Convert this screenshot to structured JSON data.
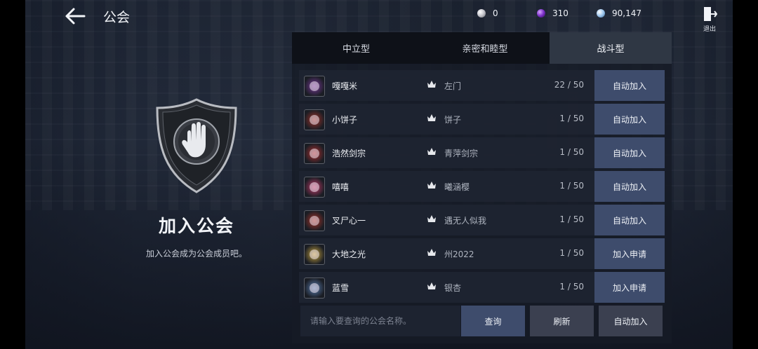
{
  "header": {
    "title": "公会",
    "exit_label": "退出"
  },
  "currencies": [
    {
      "icon": "pearl-icon",
      "value": "0"
    },
    {
      "icon": "purple-gem-icon",
      "value": "310"
    },
    {
      "icon": "crystal-icon",
      "value": "90,147"
    }
  ],
  "left": {
    "title": "加入公会",
    "desc": "加入公会成为公会成员吧。"
  },
  "tabs": [
    {
      "label": "中立型",
      "active": false
    },
    {
      "label": "亲密和睦型",
      "active": false
    },
    {
      "label": "战斗型",
      "active": true
    }
  ],
  "guilds": [
    {
      "name": "嘎嘎米",
      "leader": "左门",
      "count": "22 / 50",
      "action": "自动加入",
      "emblem_color": "#7a3a9a"
    },
    {
      "name": "小饼子",
      "leader": "饼子",
      "count": "1 / 50",
      "action": "自动加入",
      "emblem_color": "#a0322a"
    },
    {
      "name": "浩然剑宗",
      "leader": "青萍剑宗",
      "count": "1 / 50",
      "action": "自动加入",
      "emblem_color": "#b03030"
    },
    {
      "name": "嘻嘻",
      "leader": "曦涵樱",
      "count": "1 / 50",
      "action": "自动加入",
      "emblem_color": "#c23a6a"
    },
    {
      "name": "叉尸心一",
      "leader": "遇无人似我",
      "count": "1 / 50",
      "action": "自动加入",
      "emblem_color": "#a8342a"
    },
    {
      "name": "大地之光",
      "leader": "州2022",
      "count": "1 / 50",
      "action": "加入申请",
      "emblem_color": "#c9a640"
    },
    {
      "name": "蓝雪",
      "leader": "银杏",
      "count": "1 / 50",
      "action": "加入申请",
      "emblem_color": "#5a7db0"
    }
  ],
  "bottom": {
    "search_placeholder": "请输入要查询的公会名称。",
    "query": "查询",
    "refresh": "刷新",
    "auto_join": "自动加入"
  },
  "colors": {
    "accent_button": "#3e4c6c",
    "secondary_button": "#3b4050",
    "active_tab": "#2f3744"
  }
}
